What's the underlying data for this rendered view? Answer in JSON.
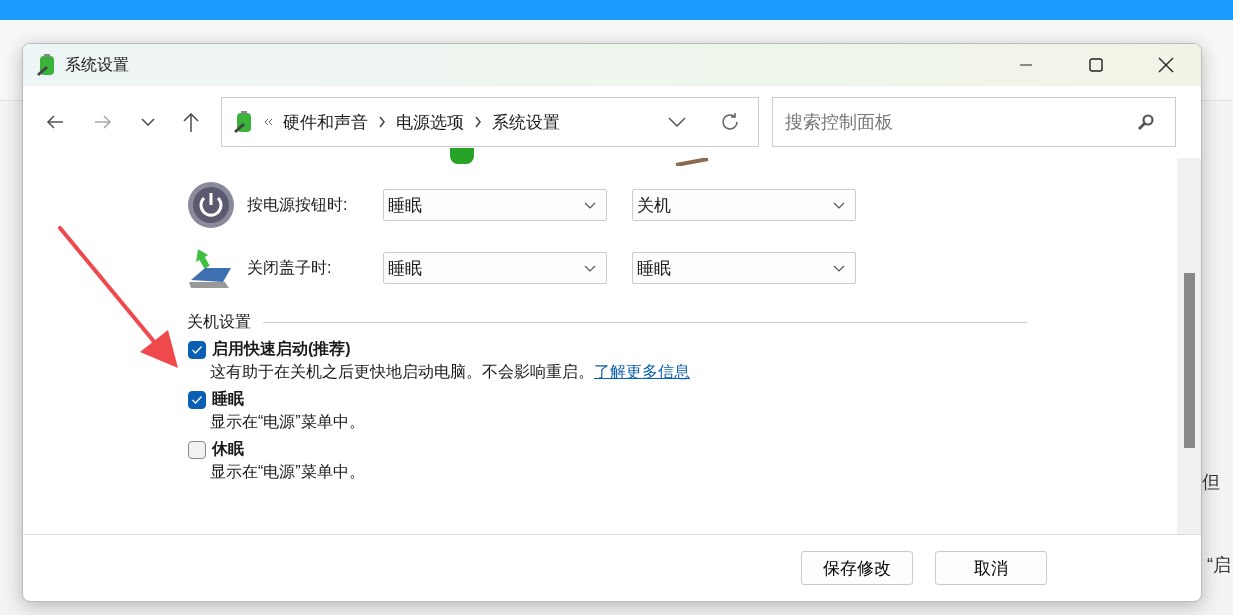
{
  "background": {
    "texts": [
      "但",
      "“启"
    ]
  },
  "window": {
    "title": "系统设置"
  },
  "nav": {
    "forward_disabled": true,
    "breadcrumb": [
      "硬件和声音",
      "电源选项",
      "系统设置"
    ],
    "search": {
      "placeholder": "搜索控制面板"
    }
  },
  "power_rows": [
    {
      "kind": "power-button",
      "label": "按电源按钮时:",
      "battery": "睡眠",
      "plugged": "关机"
    },
    {
      "kind": "lid",
      "label": "关闭盖子时:",
      "battery": "睡眠",
      "plugged": "睡眠"
    }
  ],
  "shutdown_settings": {
    "heading": "关机设置",
    "options": [
      {
        "label": "启用快速启动(推荐)",
        "checked": true,
        "description": "这有助于在关机之后更快地启动电脑。不会影响重启。",
        "link": "了解更多信息"
      },
      {
        "label": "睡眠",
        "checked": true,
        "description": "显示在“电源”菜单中。"
      },
      {
        "label": "休眠",
        "checked": false,
        "description": "显示在“电源”菜单中。"
      }
    ]
  },
  "buttons": [
    "保存修改",
    "取消"
  ]
}
